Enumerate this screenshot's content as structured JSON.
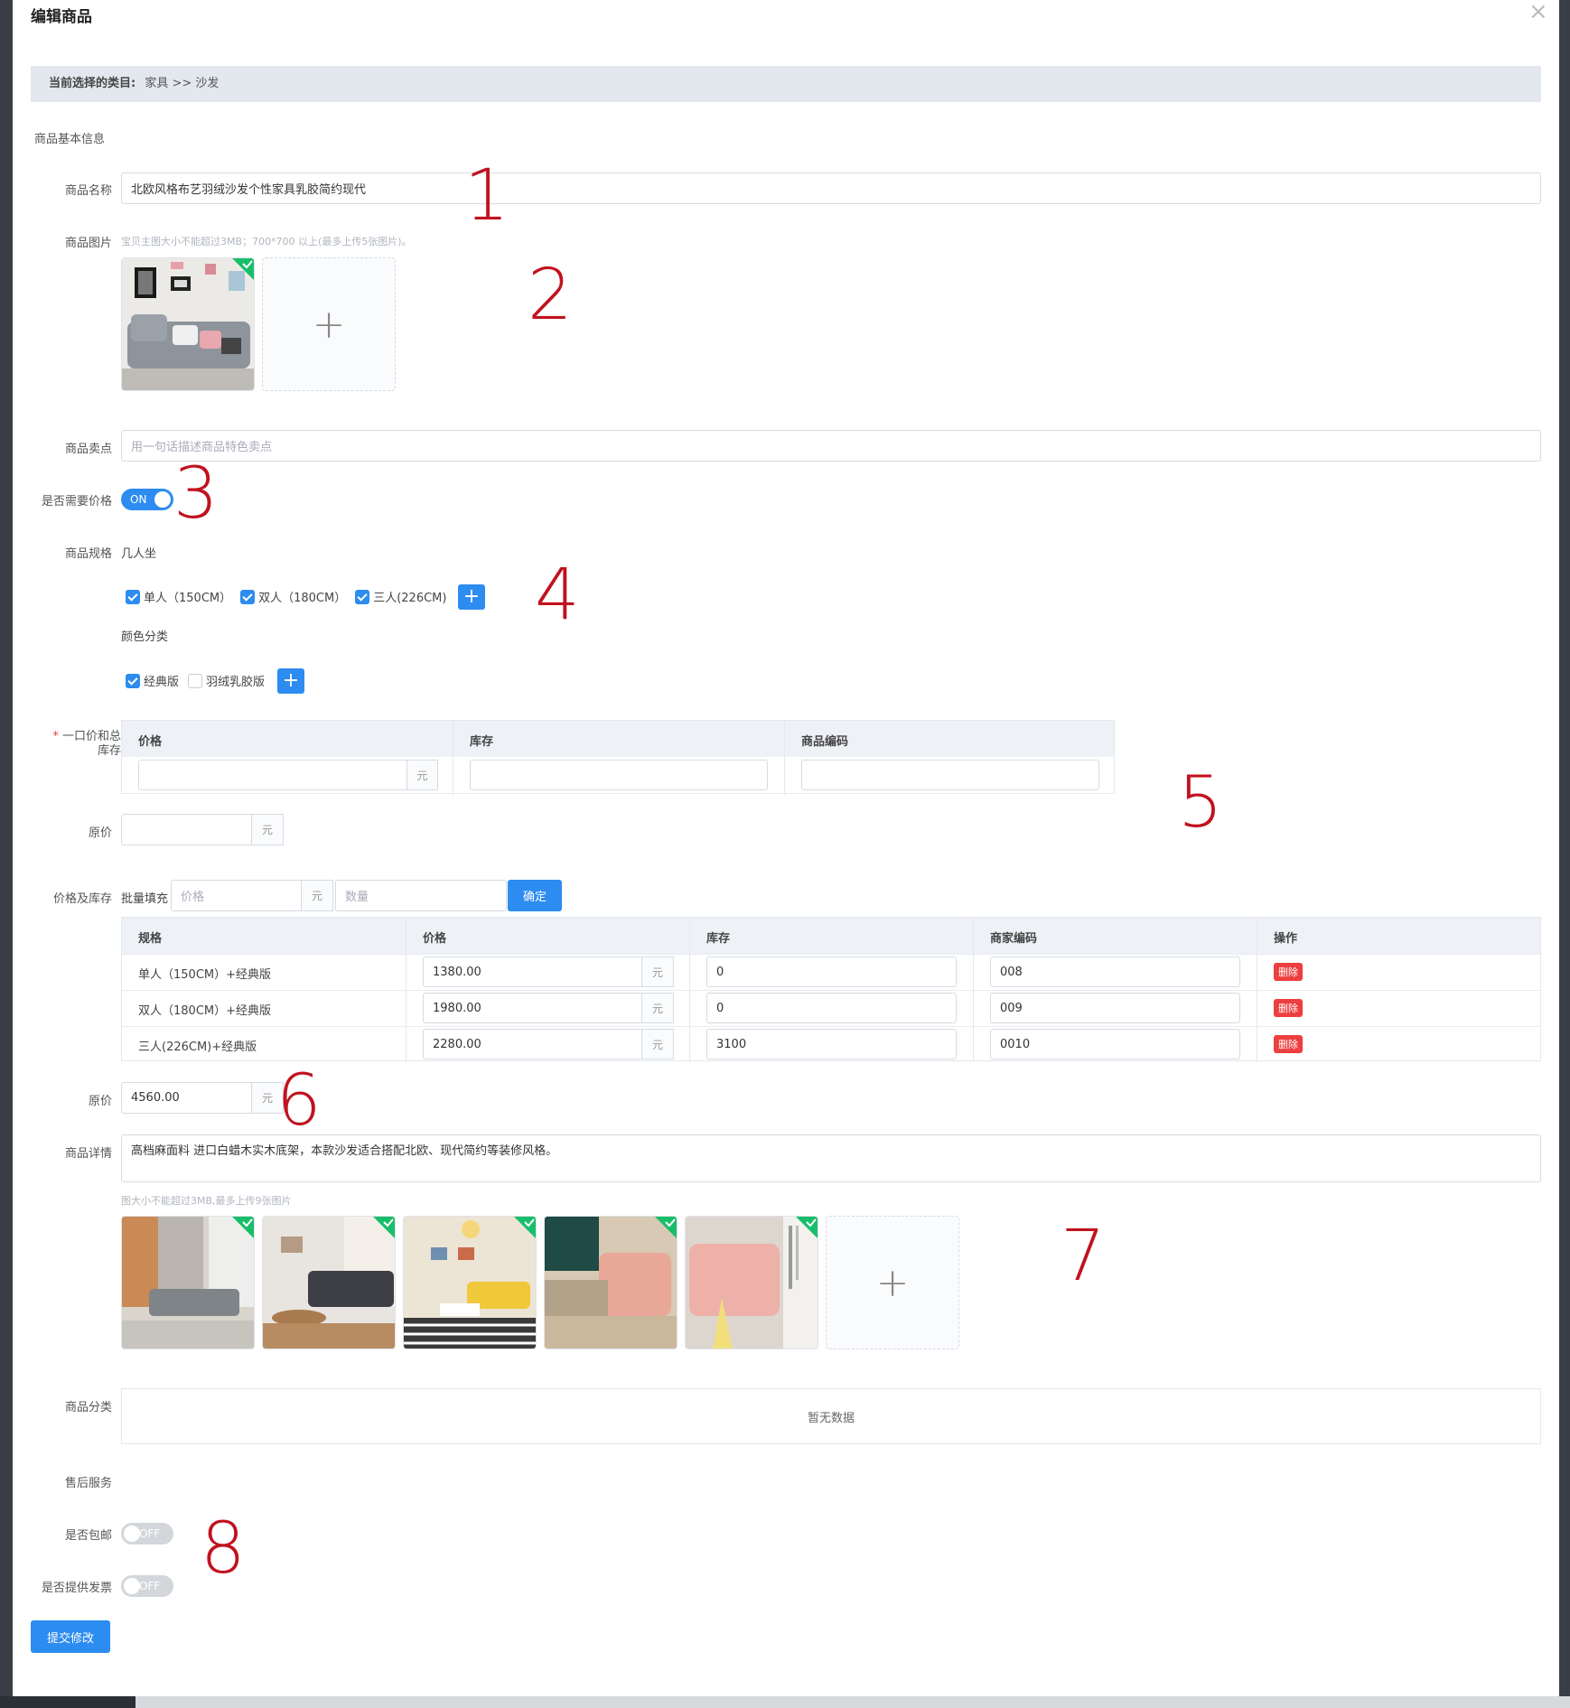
{
  "dialog": {
    "title": "编辑商品",
    "close_symbol": "×"
  },
  "breadcrumb": {
    "label": "当前选择的类目:",
    "path": "家具 >> 沙发"
  },
  "section_basic": "商品基本信息",
  "name_field": {
    "label": "商品名称",
    "value": "北欧风格布艺羽绒沙发个性家具乳胶简约现代"
  },
  "image_field": {
    "label": "商品图片",
    "hint": "宝贝主图大小不能超过3MB；700*700 以上(最多上传5张图片)。",
    "add_symbol": "+"
  },
  "selling_point": {
    "label": "商品卖点",
    "placeholder": "用一句话描述商品特色卖点"
  },
  "need_price": {
    "label": "是否需要价格",
    "state": "ON"
  },
  "spec": {
    "label": "商品规格",
    "group1": {
      "name": "几人坐",
      "options": [
        {
          "text": "单人（150CM）",
          "checked": true
        },
        {
          "text": "双人（180CM）",
          "checked": true
        },
        {
          "text": "三人(226CM)",
          "checked": true
        }
      ]
    },
    "group2": {
      "name": "颜色分类",
      "options": [
        {
          "text": "经典版",
          "checked": true
        },
        {
          "text": "羽绒乳胶版",
          "checked": false
        }
      ]
    },
    "add_symbol": "+"
  },
  "fixed_price": {
    "required_mark": "*",
    "label_line1": "一口价和总",
    "label_line2": "库存",
    "headers": [
      "价格",
      "库存",
      "商品编码"
    ],
    "unit": "元"
  },
  "orig_price_1": {
    "label": "原价",
    "value": "",
    "unit": "元"
  },
  "price_stock": {
    "label": "价格及库存",
    "batch_label": "批量填充",
    "price_placeholder": "价格",
    "unit": "元",
    "qty_placeholder": "数量",
    "confirm": "确定",
    "headers": [
      "规格",
      "价格",
      "库存",
      "商家编码",
      "操作"
    ],
    "rows": [
      {
        "spec": "单人（150CM）+经典版",
        "price": "1380.00",
        "stock": "0",
        "code": "008",
        "action": "删除"
      },
      {
        "spec": "双人（180CM）+经典版",
        "price": "1980.00",
        "stock": "0",
        "code": "009",
        "action": "删除"
      },
      {
        "spec": "三人(226CM)+经典版",
        "price": "2280.00",
        "stock": "3100",
        "code": "0010",
        "action": "删除"
      }
    ]
  },
  "orig_price_2": {
    "label": "原价",
    "value": "4560.00",
    "unit": "元"
  },
  "detail": {
    "label": "商品详情",
    "value": "高档麻面料 进口白蜡木实木底架，本款沙发适合搭配北欧、现代简约等装修风格。",
    "hint": "图大小不能超过3MB,最多上传9张图片",
    "add_symbol": "+"
  },
  "category": {
    "label": "商品分类",
    "empty_text": "暂无数据"
  },
  "after_sales": {
    "label": "售后服务"
  },
  "free_shipping": {
    "label": "是否包邮",
    "state": "OFF"
  },
  "invoice": {
    "label": "是否提供发票",
    "state": "OFF"
  },
  "submit": "提交修改",
  "annotations": [
    "1",
    "2",
    "3",
    "4",
    "5",
    "6",
    "7",
    "8"
  ],
  "colors": {
    "primary": "#2d8cf0",
    "danger": "#ed3f3f",
    "annotation": "#c1121f",
    "crumb_bg": "#e3e8ee"
  }
}
